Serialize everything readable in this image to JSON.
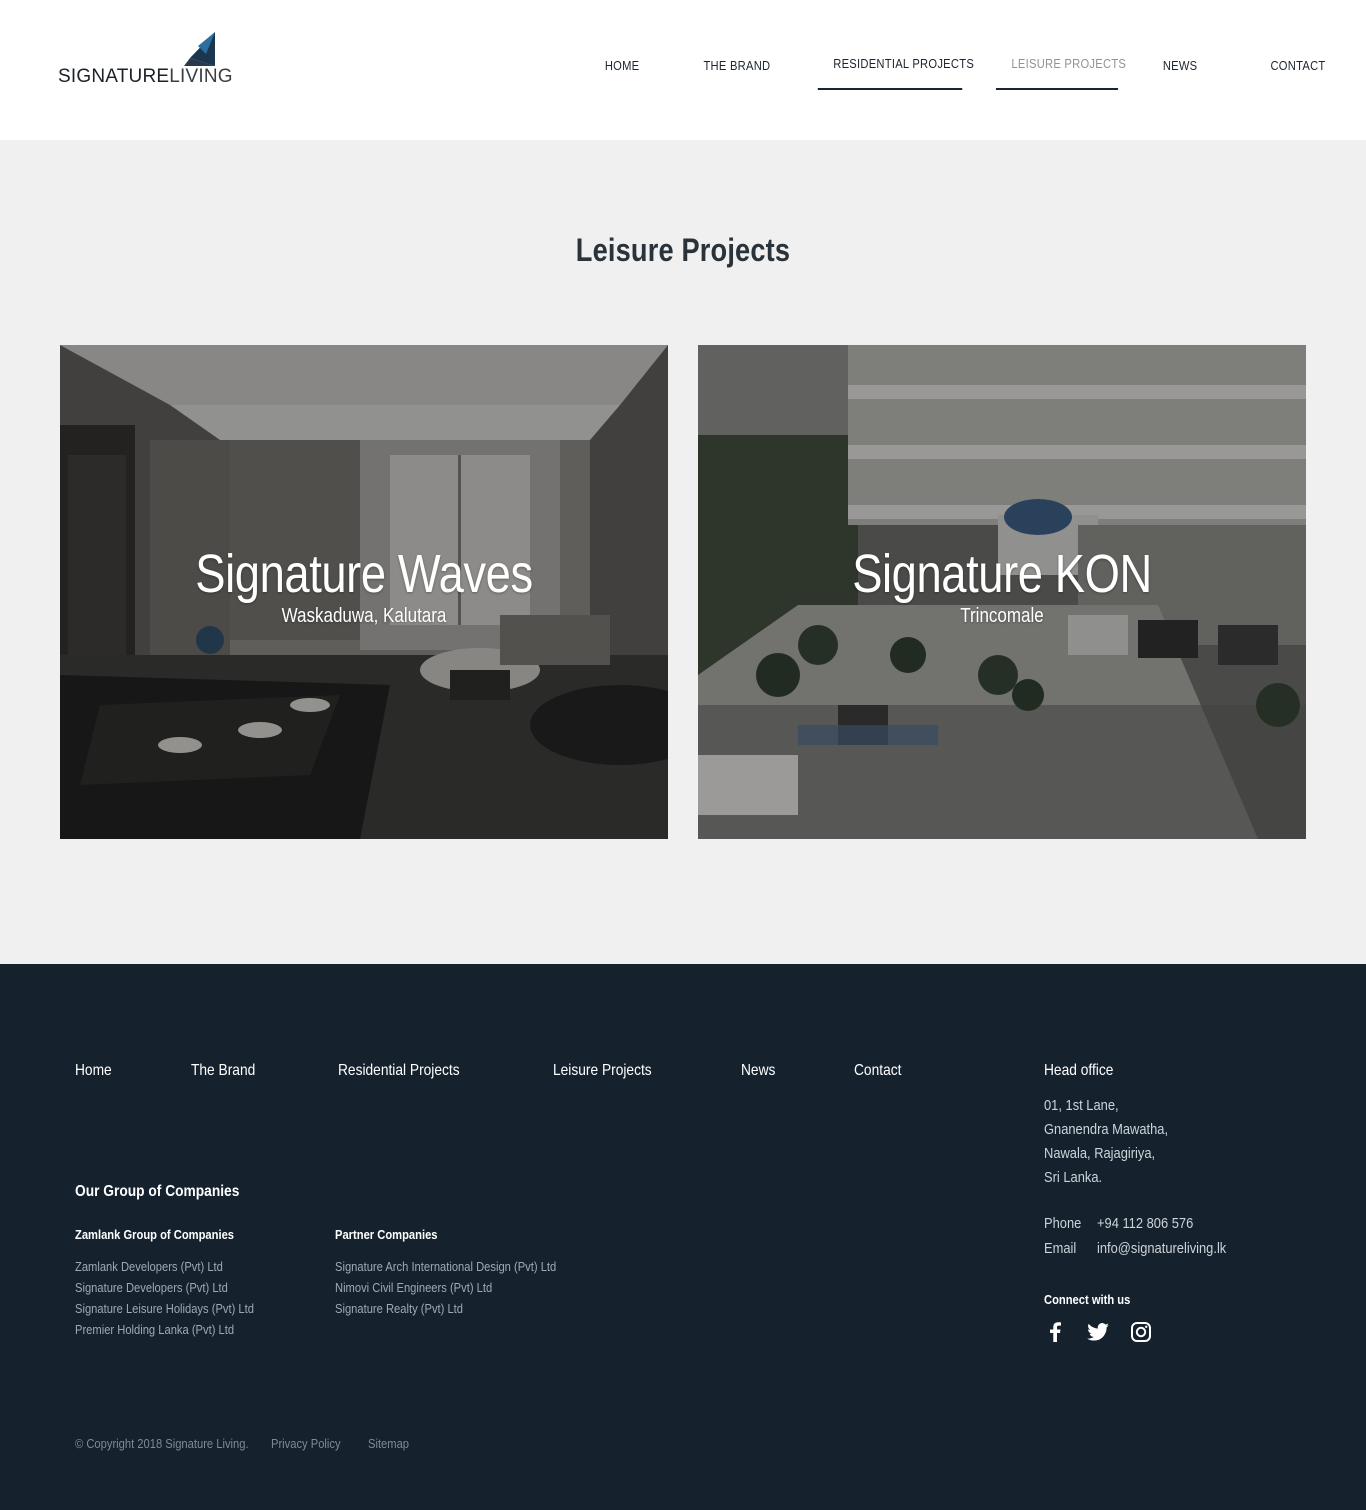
{
  "header": {
    "logo": {
      "bold": "SIGNATURE",
      "thin": "LIVING"
    },
    "nav": [
      {
        "label": "HOME"
      },
      {
        "label": "THE BRAND"
      },
      {
        "label": "RESIDENTIAL PROJECTS"
      },
      {
        "label": "LEISURE PROJECTS"
      },
      {
        "label": "NEWS"
      },
      {
        "label": "CONTACT"
      }
    ]
  },
  "main": {
    "title": "Leisure Projects",
    "projects": [
      {
        "title": "Signature Waves",
        "location": "Waskaduwa, Kalutara"
      },
      {
        "title": "Signature KON",
        "location": "Trincomale"
      }
    ]
  },
  "footer": {
    "nav": [
      {
        "label": "Home"
      },
      {
        "label": "The Brand"
      },
      {
        "label": "Residential Projects"
      },
      {
        "label": "Leisure Projects"
      },
      {
        "label": "News"
      },
      {
        "label": "Contact"
      }
    ],
    "group_title": "Our Group of Companies",
    "zamlank": {
      "heading": "Zamlank Group of Companies",
      "items": [
        "Zamlank Developers (Pvt) Ltd",
        "Signature Developers (Pvt) Ltd",
        "Signature Leisure Holidays (Pvt) Ltd",
        "Premier Holding Lanka (Pvt) Ltd"
      ]
    },
    "partners": {
      "heading": "Partner Companies",
      "items": [
        "Signature Arch International Design (Pvt) Ltd",
        "Nimovi Civil Engineers (Pvt) Ltd",
        "Signature Realty (Pvt) Ltd"
      ]
    },
    "office": {
      "title": "Head office",
      "address": [
        "01, 1st Lane,",
        "Gnanendra Mawatha,",
        "Nawala, Rajagiriya,",
        "Sri Lanka."
      ],
      "phone_label": "Phone",
      "phone": "+94 112 806 576",
      "email_label": "Email",
      "email": "info@signatureliving.lk",
      "connect": "Connect with us",
      "socials": [
        "facebook-icon",
        "twitter-icon",
        "instagram-icon"
      ]
    },
    "bottom": {
      "copyright": "© Copyright 2018 Signature Living.",
      "privacy": "Privacy Policy",
      "sitemap": "Sitemap"
    }
  }
}
